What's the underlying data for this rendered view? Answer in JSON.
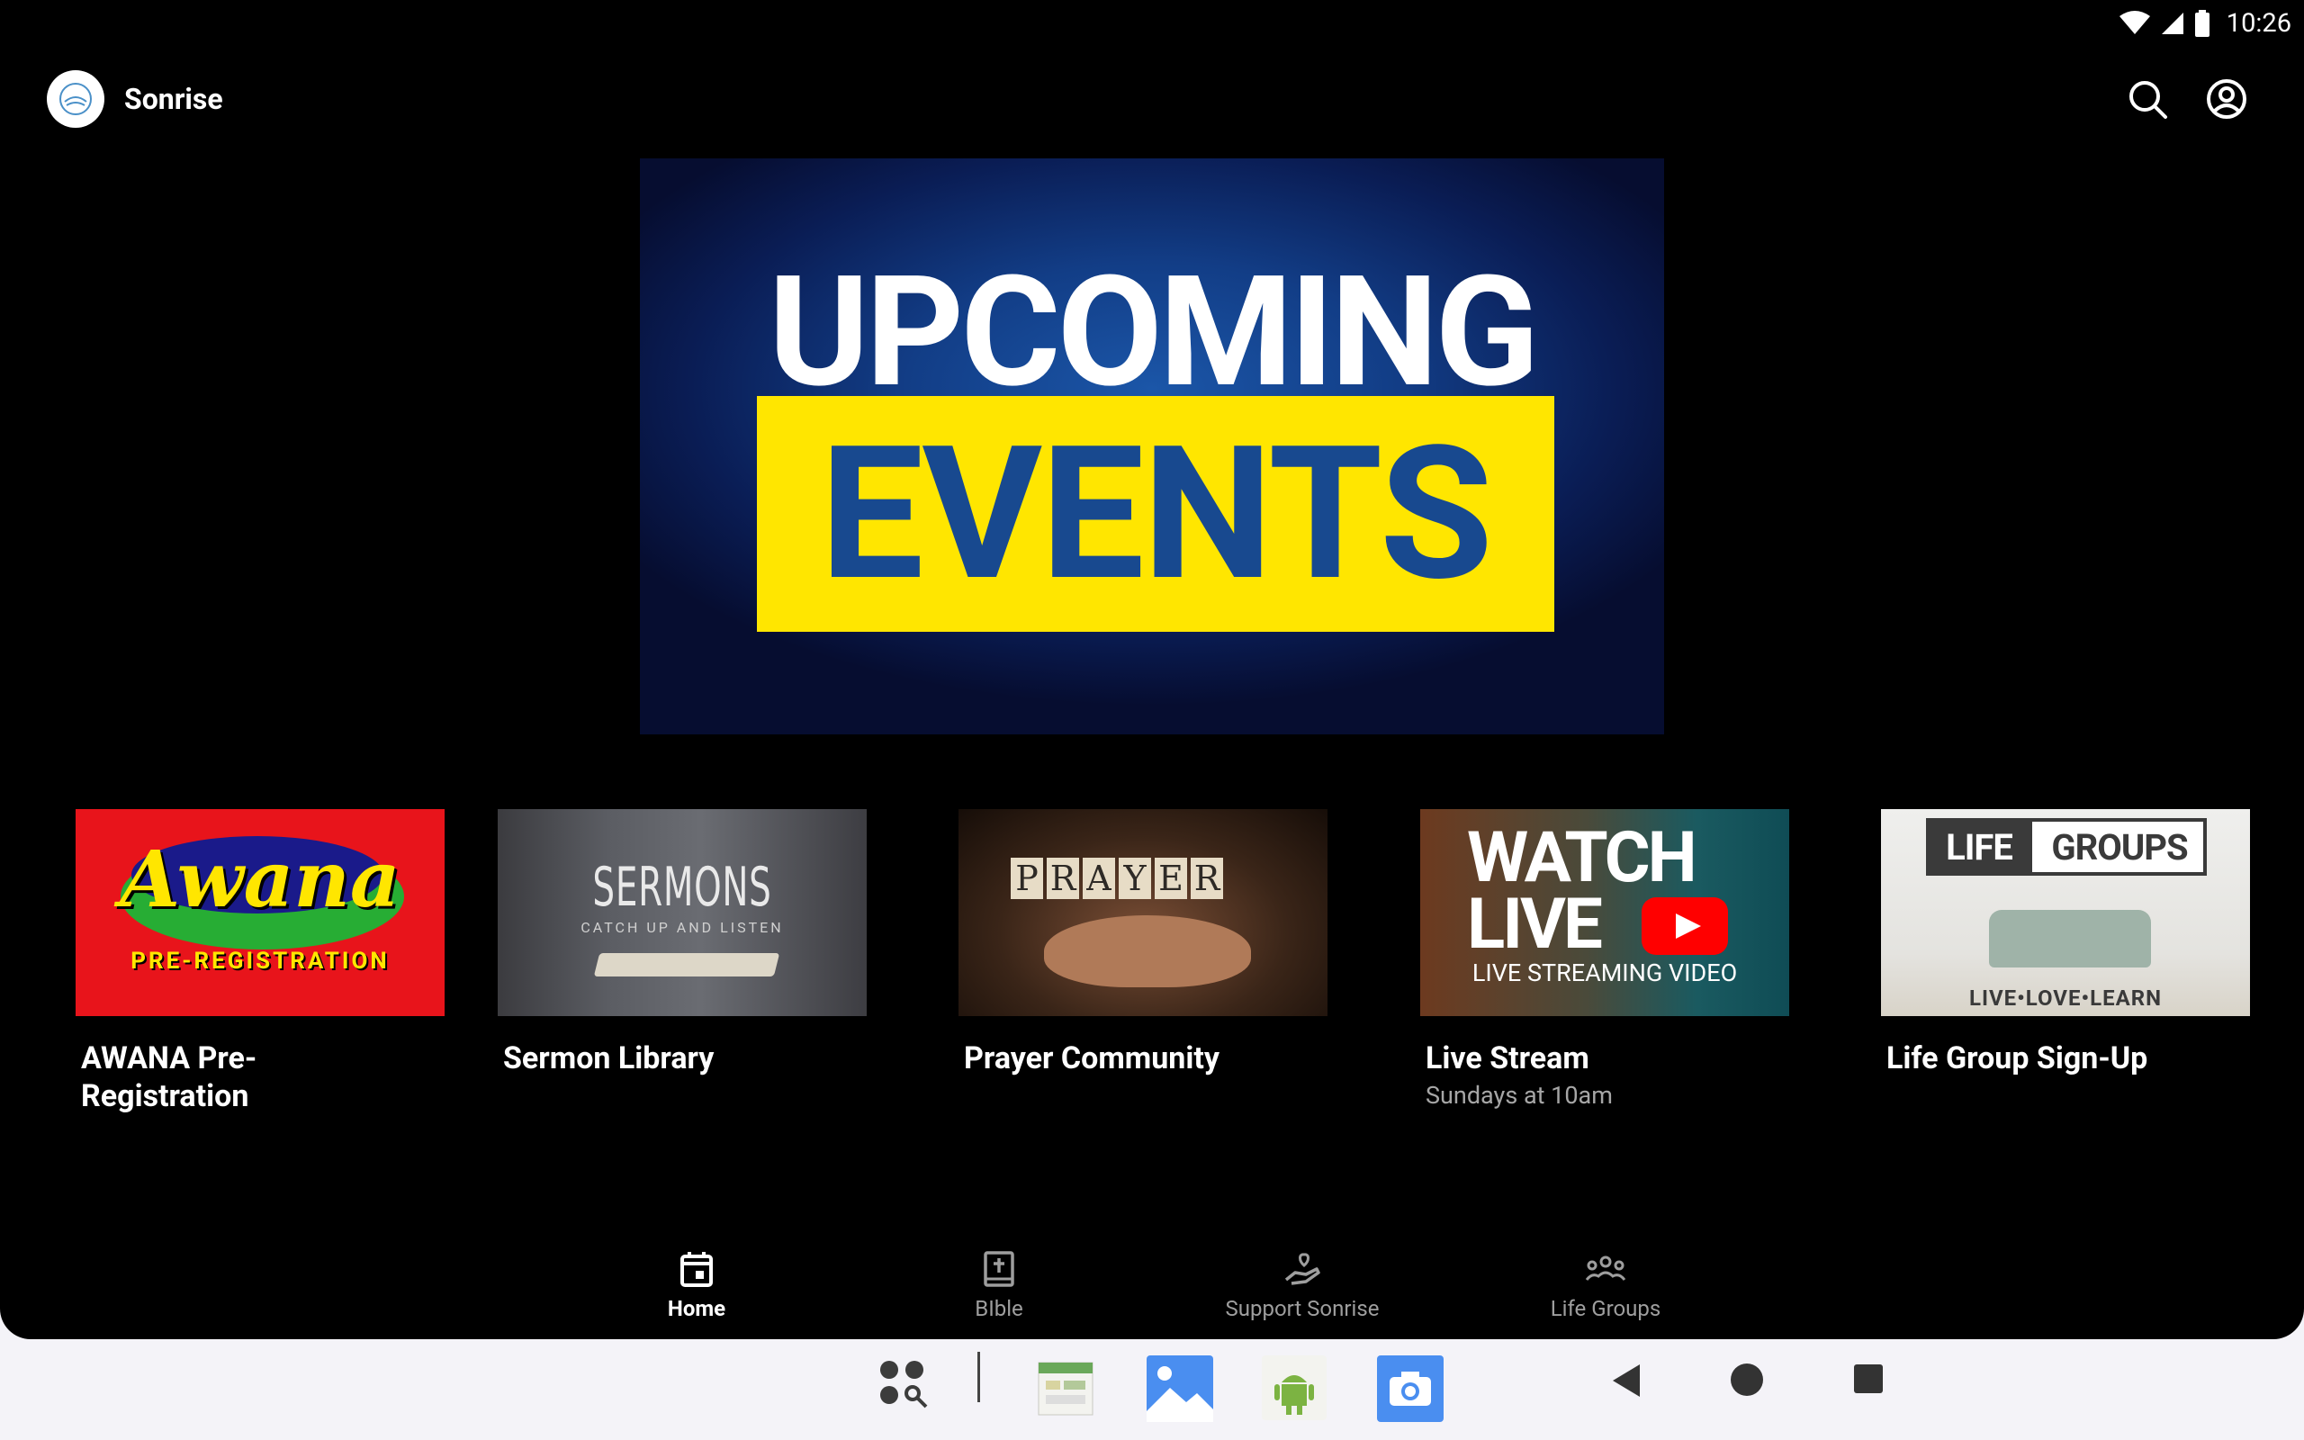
{
  "status_bar": {
    "time": "10:26"
  },
  "header": {
    "app_name": "Sonrise"
  },
  "hero": {
    "line1": "UPCOMING",
    "line2": "EVENTS"
  },
  "cards": [
    {
      "title": "AWANA Pre-Registration",
      "subtitle": "",
      "thumb": {
        "word": "Awana",
        "caption": "PRE-REGISTRATION"
      }
    },
    {
      "title": "Sermon Library",
      "subtitle": "",
      "thumb": {
        "word": "SERMONS",
        "caption": "CATCH UP AND LISTEN"
      }
    },
    {
      "title": "Prayer Community",
      "subtitle": "",
      "thumb": {
        "word": "PRAYER"
      }
    },
    {
      "title": "Live Stream",
      "subtitle": "Sundays at 10am",
      "thumb": {
        "word": "WATCH LIVE",
        "caption": "LIVE STREAMING VIDEO"
      }
    },
    {
      "title": "Life Group Sign-Up",
      "subtitle": "",
      "thumb": {
        "word_left": "LIFE",
        "word_right": "GROUPS",
        "caption": "LIVE•LOVE•LEARN"
      }
    }
  ],
  "bottom_nav": [
    {
      "label": "Home",
      "icon": "calendar-icon",
      "active": true
    },
    {
      "label": "BIble",
      "icon": "bible-icon",
      "active": false
    },
    {
      "label": "Support Sonrise",
      "icon": "hand-heart-icon",
      "active": false
    },
    {
      "label": "Life Groups",
      "icon": "people-group-icon",
      "active": false
    }
  ],
  "dock": [
    "app-drawer-icon",
    "calendar-app-icon",
    "gallery-icon",
    "android-app-icon",
    "camera-icon",
    "back-icon",
    "home-icon",
    "recents-icon"
  ],
  "colors": {
    "accent_yellow": "#ffe600",
    "accent_blue": "#18498f",
    "youtube_red": "#ff0000",
    "awana_red": "#e8141b"
  }
}
